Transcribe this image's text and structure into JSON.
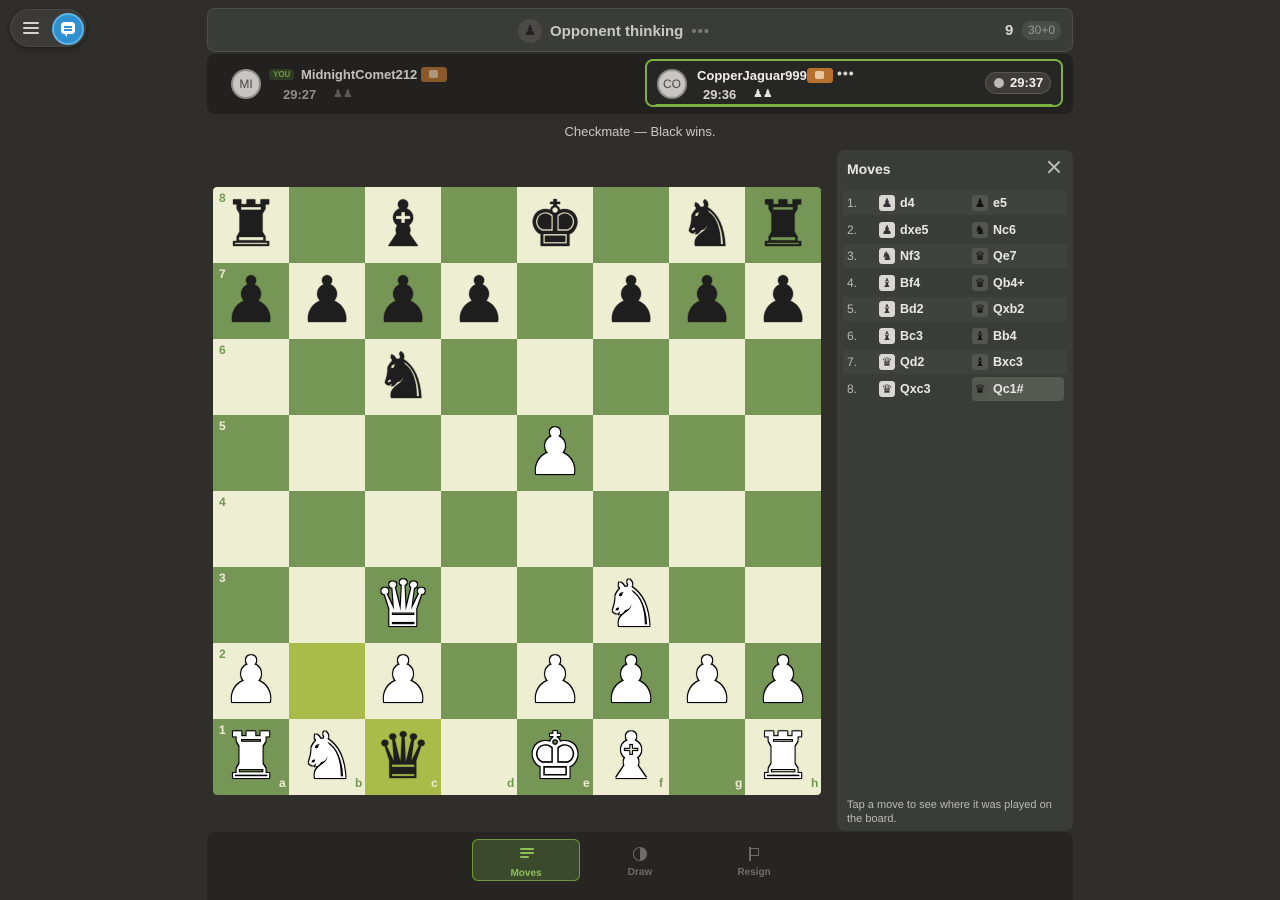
{
  "status": {
    "text": "Opponent thinking",
    "dots": "•••",
    "move_count": "9",
    "time_control": "30+0"
  },
  "players": {
    "self": {
      "initials": "MI",
      "badge": "YOU",
      "name": "MidnightComet212",
      "clock": "29:27",
      "captured": "♟♟"
    },
    "opponent": {
      "initials": "CO",
      "name": "CopperJaguar999",
      "more": "•••",
      "clock": "29:36",
      "captured": "♟♟",
      "live_clock": "29:37"
    }
  },
  "result_text": "Checkmate — Black wins.",
  "board": {
    "ranks": [
      "8",
      "7",
      "6",
      "5",
      "4",
      "3",
      "2",
      "1"
    ],
    "files": [
      "a",
      "b",
      "c",
      "d",
      "e",
      "f",
      "g",
      "h"
    ],
    "highlight_squares": [
      "b2",
      "c1"
    ],
    "pieces": [
      {
        "sq": "a8",
        "p": "r",
        "c": "b"
      },
      {
        "sq": "c8",
        "p": "b",
        "c": "b"
      },
      {
        "sq": "e8",
        "p": "k",
        "c": "b"
      },
      {
        "sq": "g8",
        "p": "n",
        "c": "b"
      },
      {
        "sq": "h8",
        "p": "r",
        "c": "b"
      },
      {
        "sq": "a7",
        "p": "p",
        "c": "b"
      },
      {
        "sq": "b7",
        "p": "p",
        "c": "b"
      },
      {
        "sq": "c7",
        "p": "p",
        "c": "b"
      },
      {
        "sq": "d7",
        "p": "p",
        "c": "b"
      },
      {
        "sq": "f7",
        "p": "p",
        "c": "b"
      },
      {
        "sq": "g7",
        "p": "p",
        "c": "b"
      },
      {
        "sq": "h7",
        "p": "p",
        "c": "b"
      },
      {
        "sq": "c6",
        "p": "n",
        "c": "b"
      },
      {
        "sq": "e5",
        "p": "p",
        "c": "w"
      },
      {
        "sq": "c3",
        "p": "q",
        "c": "w"
      },
      {
        "sq": "f3",
        "p": "n",
        "c": "w"
      },
      {
        "sq": "a2",
        "p": "p",
        "c": "w"
      },
      {
        "sq": "c2",
        "p": "p",
        "c": "w"
      },
      {
        "sq": "e2",
        "p": "p",
        "c": "w"
      },
      {
        "sq": "f2",
        "p": "p",
        "c": "w"
      },
      {
        "sq": "g2",
        "p": "p",
        "c": "w"
      },
      {
        "sq": "h2",
        "p": "p",
        "c": "w"
      },
      {
        "sq": "a1",
        "p": "r",
        "c": "w"
      },
      {
        "sq": "b1",
        "p": "n",
        "c": "w"
      },
      {
        "sq": "c1",
        "p": "q",
        "c": "b"
      },
      {
        "sq": "e1",
        "p": "k",
        "c": "w"
      },
      {
        "sq": "f1",
        "p": "b",
        "c": "w"
      },
      {
        "sq": "h1",
        "p": "r",
        "c": "w"
      }
    ]
  },
  "moves_panel": {
    "title": "Moves",
    "moves": [
      {
        "num": "1.",
        "white": "d4",
        "wp": "p",
        "black": "e5",
        "bp": "p"
      },
      {
        "num": "2.",
        "white": "dxe5",
        "wp": "p",
        "black": "Nc6",
        "bp": "n"
      },
      {
        "num": "3.",
        "white": "Nf3",
        "wp": "n",
        "black": "Qe7",
        "bp": "q"
      },
      {
        "num": "4.",
        "white": "Bf4",
        "wp": "b",
        "black": "Qb4+",
        "bp": "q"
      },
      {
        "num": "5.",
        "white": "Bd2",
        "wp": "b",
        "black": "Qxb2",
        "bp": "q"
      },
      {
        "num": "6.",
        "white": "Bc3",
        "wp": "b",
        "black": "Bb4",
        "bp": "b"
      },
      {
        "num": "7.",
        "white": "Qd2",
        "wp": "q",
        "black": "Bxc3",
        "bp": "b"
      },
      {
        "num": "8.",
        "white": "Qxc3",
        "wp": "q",
        "black": "Qc1#",
        "bp": "q"
      }
    ],
    "hint": "Tap a move to see where it was played on the board."
  },
  "bottom_tabs": [
    {
      "label": "Moves",
      "icon": "list-icon",
      "active": true
    },
    {
      "label": "Draw",
      "icon": "half-circle-icon",
      "active": false
    },
    {
      "label": "Resign",
      "icon": "flag-icon",
      "active": false
    }
  ],
  "colors": {
    "light_square": "#eeeed2",
    "dark_square": "#769656",
    "accent": "#7ab342"
  }
}
